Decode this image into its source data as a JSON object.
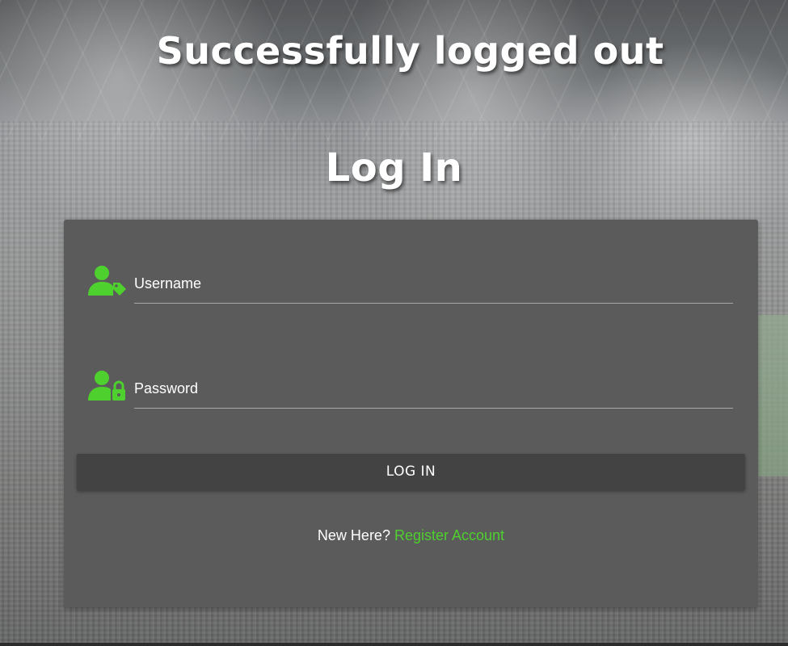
{
  "messages": {
    "logout_notice": "Successfully logged out",
    "form_title": "Log In"
  },
  "form": {
    "username": {
      "placeholder": "Username",
      "value": "",
      "icon": "user-tag-icon"
    },
    "password": {
      "placeholder": "Password",
      "value": "",
      "icon": "user-lock-icon"
    },
    "submit_label": "LOG IN",
    "register_prompt": "New Here?",
    "register_link": "Register Account"
  },
  "colors": {
    "accent": "#4ed02e",
    "card": "#5b5b5b",
    "button": "#434343"
  }
}
